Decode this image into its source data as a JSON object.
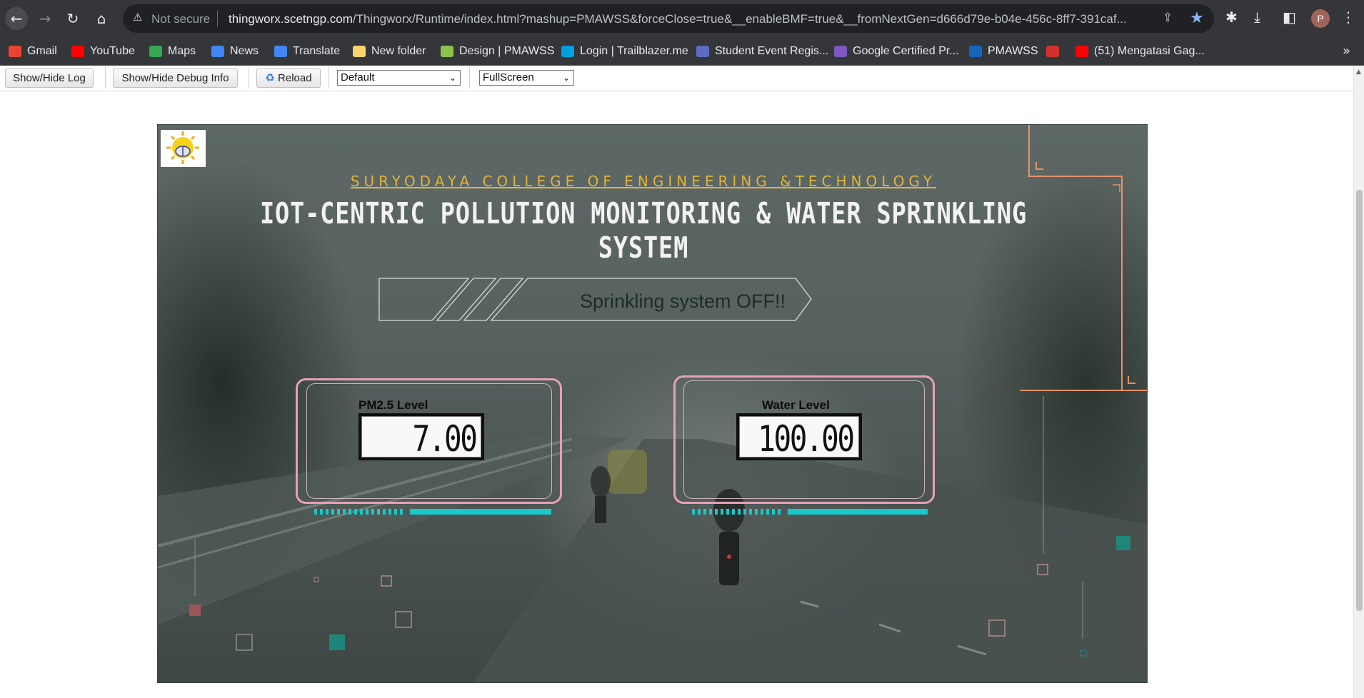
{
  "browser": {
    "not_secure": "Not secure",
    "url_host": "thingworx.scetngp.com",
    "url_path": "/Thingworx/Runtime/index.html?mashup=PMAWSS&forceClose=true&__enableBMF=true&__fromNextGen=d666d79e-b04e-456c-8ff7-391caf...",
    "profile_initial": "P"
  },
  "bookmarks": [
    {
      "label": "Gmail",
      "color": "#ea4335"
    },
    {
      "label": "YouTube",
      "color": "#ff0000"
    },
    {
      "label": "Maps",
      "color": "#34a853"
    },
    {
      "label": "News",
      "color": "#4285f4"
    },
    {
      "label": "Translate",
      "color": "#4285f4"
    },
    {
      "label": "New folder",
      "color": "#f9d46b"
    },
    {
      "label": "Design | PMAWSS",
      "color": "#8bc34a"
    },
    {
      "label": "Login | Trailblazer.me",
      "color": "#00a1e0"
    },
    {
      "label": "Student Event Regis...",
      "color": "#5c6bc0"
    },
    {
      "label": "Google Certified Pr...",
      "color": "#7e57c2"
    },
    {
      "label": "PMAWSS",
      "color": "#1565c0"
    },
    {
      "label": "",
      "color": "#d32f2f"
    },
    {
      "label": "(51) Mengatasi Gag...",
      "color": "#ff0000"
    }
  ],
  "toolbar": {
    "show_hide_log": "Show/Hide Log",
    "show_hide_debug": "Show/Hide Debug Info",
    "reload": "Reload",
    "theme_select": "Default",
    "view_select": "FullScreen"
  },
  "mashup": {
    "college": "SURYODAYA COLLEGE OF ENGINEERING &TECHNOLOGY",
    "title": "IOT-CENTRIC POLLUTION MONITORING & WATER SPRINKLING SYSTEM",
    "status": "Sprinkling system OFF!!",
    "pm25": {
      "label": "PM2.5 Level",
      "value": "7.00"
    },
    "water": {
      "label": "Water Level",
      "value": "100.00"
    },
    "colors": {
      "accent_gold": "#e2b43a",
      "frame_pink": "#e8a0b4",
      "bar_cyan": "#19c9c9",
      "corner_orange": "#e8916a"
    }
  }
}
